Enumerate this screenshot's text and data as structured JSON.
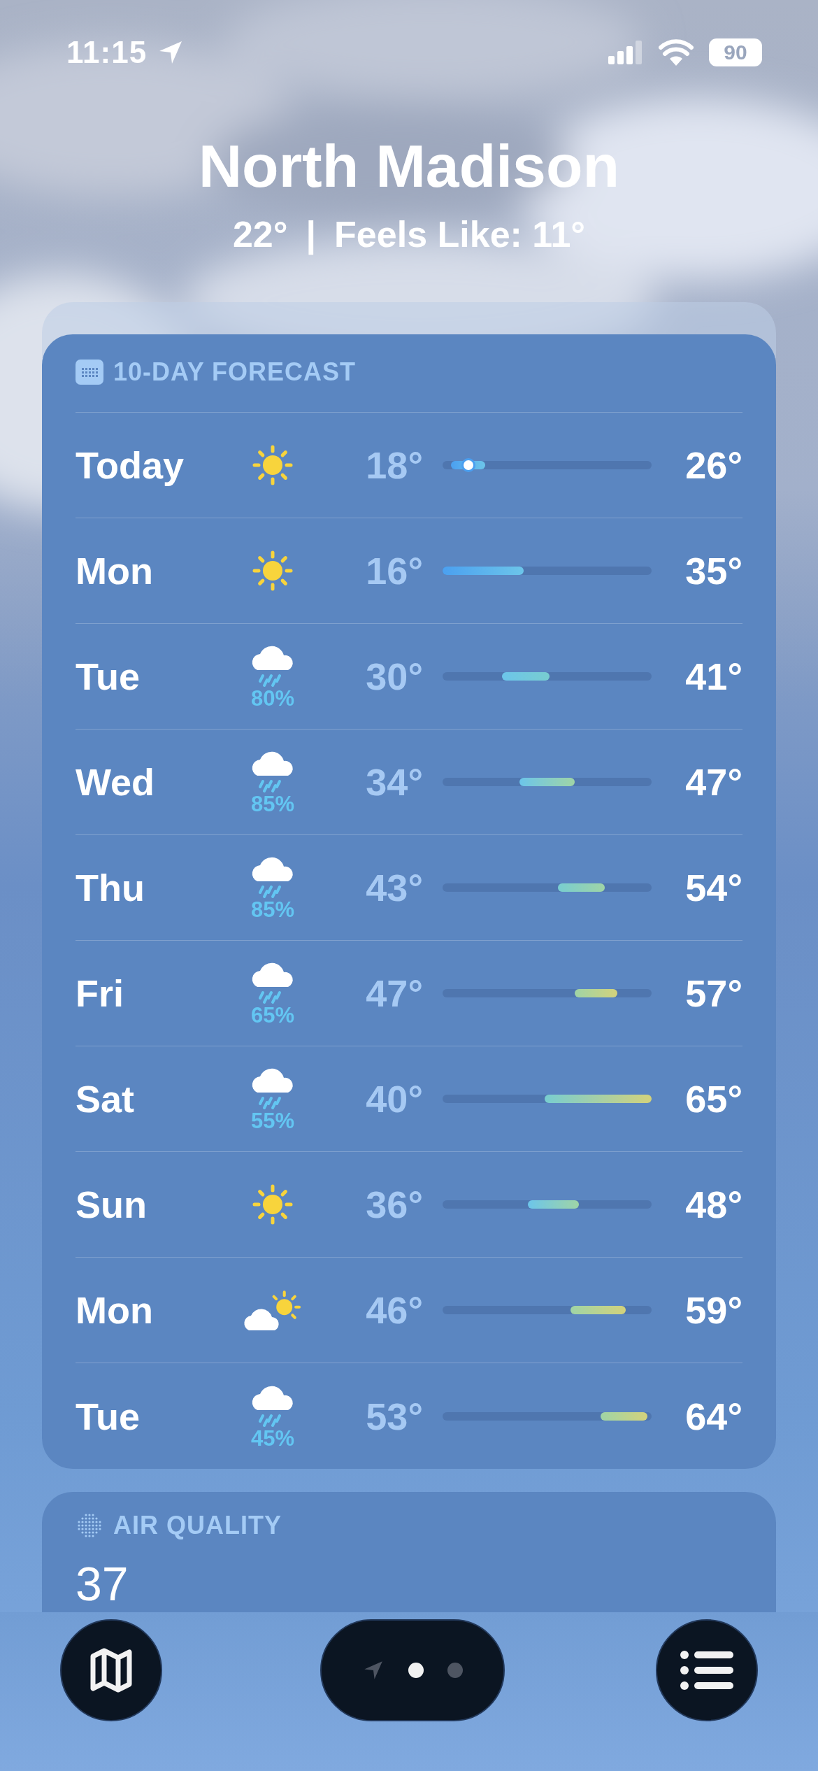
{
  "status_bar": {
    "time": "11:15",
    "battery": "90"
  },
  "location": {
    "name": "North Madison",
    "temperature": "22°",
    "separator": "|",
    "feels_like": "Feels Like: 11°"
  },
  "forecast": {
    "title": "10-DAY FORECAST",
    "days": [
      {
        "day": "Today",
        "kind": "sunny",
        "low": "18°",
        "high": "26°",
        "current": true
      },
      {
        "day": "Mon",
        "kind": "sunny",
        "low": "16°",
        "high": "35°",
        "current": false
      },
      {
        "day": "Tue",
        "kind": "rain",
        "precip": "80%",
        "low": "30°",
        "high": "41°",
        "current": false
      },
      {
        "day": "Wed",
        "kind": "rain",
        "precip": "85%",
        "low": "34°",
        "high": "47°",
        "current": false
      },
      {
        "day": "Thu",
        "kind": "rain",
        "precip": "85%",
        "low": "43°",
        "high": "54°",
        "current": false
      },
      {
        "day": "Fri",
        "kind": "rain",
        "precip": "65%",
        "low": "47°",
        "high": "57°",
        "current": false
      },
      {
        "day": "Sat",
        "kind": "rain",
        "precip": "55%",
        "low": "40°",
        "high": "65°",
        "current": false
      },
      {
        "day": "Sun",
        "kind": "sunny",
        "low": "36°",
        "high": "48°",
        "current": false
      },
      {
        "day": "Mon",
        "kind": "partly-sunny",
        "low": "46°",
        "high": "59°",
        "current": false
      },
      {
        "day": "Tue",
        "kind": "rain",
        "precip": "45%",
        "low": "53°",
        "high": "64°",
        "current": false
      }
    ]
  },
  "air_quality": {
    "title": "AIR QUALITY",
    "value": "37"
  },
  "toolbar": {
    "pages": [
      {
        "kind": "location",
        "selected": false
      },
      {
        "kind": "dot",
        "selected": true
      },
      {
        "kind": "dot",
        "selected": false
      }
    ]
  }
}
